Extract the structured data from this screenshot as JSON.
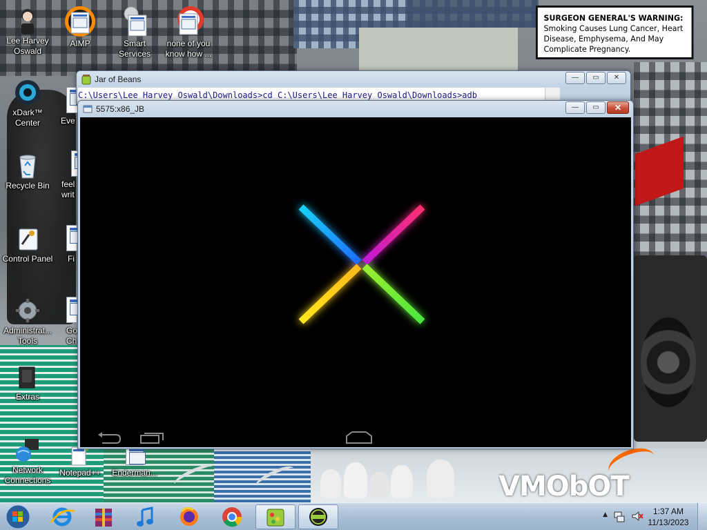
{
  "desktop": {
    "icons": [
      {
        "label": "Lee Harvey Oswald",
        "icon": "user-figure-icon"
      },
      {
        "label": "AIMP",
        "icon": "document-icon"
      },
      {
        "label": "Smart Services",
        "icon": "document-icon"
      },
      {
        "label": "none of you know how ...",
        "icon": "document-icon"
      },
      {
        "label": "xDark™ Center",
        "icon": "xdark-center-icon"
      },
      {
        "label": "Eve",
        "icon": "document-icon"
      },
      {
        "label": "Recycle Bin",
        "icon": "recycle-bin-icon"
      },
      {
        "label": "feel writ",
        "icon": "document-icon"
      },
      {
        "label": "Control Panel",
        "icon": "control-panel-icon"
      },
      {
        "label": "Fi",
        "icon": "document-icon"
      },
      {
        "label": "Administrat... Tools",
        "icon": "admin-tools-icon"
      },
      {
        "label": "Go Ch",
        "icon": "document-icon"
      },
      {
        "label": "Extras",
        "icon": "extras-icon"
      },
      {
        "label": "Network Connections",
        "icon": "network-icon"
      },
      {
        "label": "Notepad++",
        "icon": "document-icon"
      },
      {
        "label": "Enderman...",
        "icon": "document-icon"
      }
    ]
  },
  "overlay": {
    "warning_bold": "SURGEON GENERAL'S WARNING:",
    "warning_text": "Smoking Causes Lung Cancer, Heart Disease, Emphysema, And May Complicate Pregnancy.",
    "watermark": "VMObOT"
  },
  "jar_window": {
    "title": "Jar of Beans",
    "console_line": "C:\\Users\\Lee Harvey Oswald\\Downloads>cd C:\\Users\\Lee Harvey Oswald\\Downloads>adb"
  },
  "emulator_window": {
    "title": "5575:x86_JB",
    "nav": {
      "back": "back-icon",
      "home": "home-icon",
      "recents": "recents-icon"
    }
  },
  "taskbar": {
    "time": "1:37 AM",
    "date": "11/13/2023",
    "pinned": [
      "start-orb-icon",
      "internet-explorer-icon",
      "winrar-icon",
      "music-player-icon",
      "firefox-icon",
      "chrome-icon",
      "jar-of-beans-icon",
      "android-emulator-icon"
    ]
  },
  "colors": {
    "x_cyan": "#19d3f5",
    "x_magenta": "#ff2f6e",
    "x_yellow": "#ffe71f",
    "x_green": "#4ce53f"
  }
}
